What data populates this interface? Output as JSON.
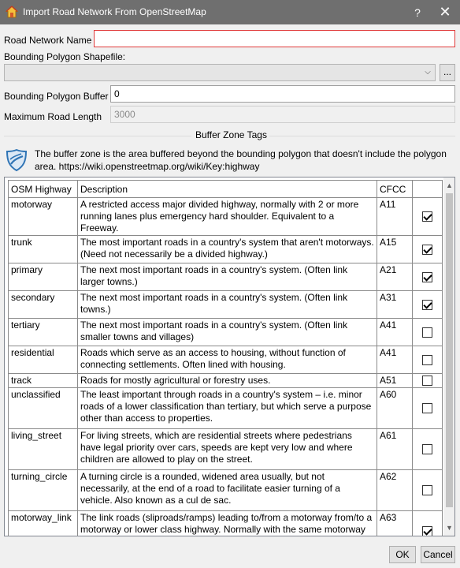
{
  "window": {
    "title": "Import Road Network From OpenStreetMap",
    "help_glyph": "?",
    "close_glyph": "✕"
  },
  "form": {
    "road_network_name_label": "Road Network Name",
    "road_network_name_value": "",
    "shapefile_label": "Bounding Polygon Shapefile:",
    "shapefile_value": "",
    "browse_label": "...",
    "buffer_label": "Bounding Polygon Buffer",
    "buffer_value": "0",
    "max_length_label": "Maximum Road Length",
    "max_length_placeholder": "3000"
  },
  "buffer_zone": {
    "section_title": "Buffer Zone Tags",
    "info_text": "The buffer zone is the area buffered beyond the bounding polygon that doesn't include the polygon area. https://wiki.openstreetmap.org/wiki/Key:highway"
  },
  "table": {
    "headers": {
      "highway": "OSM Highway",
      "description": "Description",
      "cfcc": "CFCC"
    },
    "rows": [
      {
        "highway": "motorway",
        "description": "A restricted access major divided highway, normally with 2 or more running lanes plus emergency hard shoulder. Equivalent to a Freeway.",
        "cfcc": "A11",
        "checked": true
      },
      {
        "highway": "trunk",
        "description": "The most important roads in a country's system that aren't motorways. (Need not necessarily be a divided highway.)",
        "cfcc": "A15",
        "checked": true
      },
      {
        "highway": "primary",
        "description": "The next most important roads in a country's system. (Often link larger towns.)",
        "cfcc": "A21",
        "checked": true
      },
      {
        "highway": "secondary",
        "description": "The next most important roads in a country's system. (Often link towns.)",
        "cfcc": "A31",
        "checked": true
      },
      {
        "highway": "tertiary",
        "description": "The next most important roads in a country's system. (Often link smaller towns and villages)",
        "cfcc": "A41",
        "checked": false
      },
      {
        "highway": "residential",
        "description": "Roads which serve as an access to housing, without function of connecting settlements. Often lined with housing.",
        "cfcc": "A41",
        "checked": false
      },
      {
        "highway": "track",
        "description": "Roads for mostly agricultural or forestry uses.",
        "cfcc": "A51",
        "checked": false
      },
      {
        "highway": "unclassified",
        "description": "The least important through roads in a country's system – i.e. minor roads of a lower classification than tertiary, but which serve a purpose other than access to properties.",
        "cfcc": "A60",
        "checked": false
      },
      {
        "highway": "living_street",
        "description": "For living streets, which are residential streets where pedestrians have legal priority over cars, speeds are kept very low and where children are allowed to play on the street.",
        "cfcc": "A61",
        "checked": false
      },
      {
        "highway": "turning_circle",
        "description": "A turning circle is a rounded, widened area usually, but not necessarily, at the end of a road to facilitate easier turning of a vehicle. Also known as a cul de sac.",
        "cfcc": "A62",
        "checked": false
      },
      {
        "highway": "motorway_link",
        "description": "The link roads (sliproads/ramps) leading to/from a motorway from/to a motorway or lower class highway. Normally with the same motorway restrictions.",
        "cfcc": "A63",
        "checked": true
      }
    ]
  },
  "buttons": {
    "ok": "OK",
    "cancel": "Cancel"
  },
  "icons": {
    "app": "home-icon",
    "info": "shield-info-icon"
  },
  "colors": {
    "titlebar": "#6f6f6f",
    "invalid_border": "#e03a3a",
    "dialog_bg": "#f0f0f0"
  }
}
